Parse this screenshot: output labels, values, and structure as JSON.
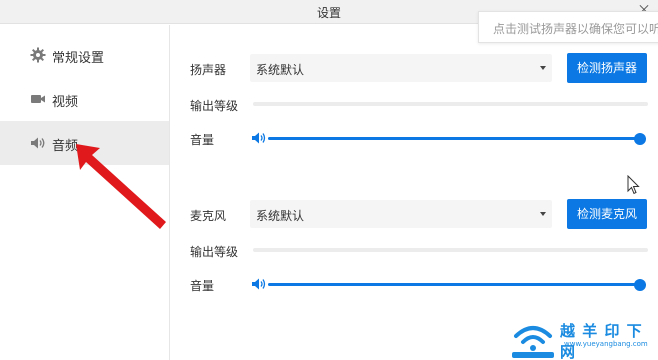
{
  "window": {
    "title": "设置"
  },
  "tooltip": {
    "text": "点击测试扬声器以确保您可以听到"
  },
  "sidebar": {
    "items": [
      {
        "label": "常规设置",
        "icon": "gear-icon",
        "active": false
      },
      {
        "label": "视频",
        "icon": "video-camera-icon",
        "active": false
      },
      {
        "label": "音频",
        "icon": "speaker-icon",
        "active": true
      }
    ]
  },
  "speaker_section": {
    "label": "扬声器",
    "device": "系统默认",
    "test_button": "检测扬声器",
    "level_label": "输出等级",
    "level_value": 0,
    "volume_label": "音量",
    "volume_value": 1.0
  },
  "mic_section": {
    "label": "麦克风",
    "device": "系统默认",
    "test_button": "检测麦克风",
    "level_label": "输出等级",
    "level_value": 0,
    "volume_label": "音量",
    "volume_value": 1.0
  },
  "watermark": {
    "title": "越 羊 印 下 网",
    "url": "www.yueyangbang.com"
  },
  "colors": {
    "accent": "#0b78e3",
    "annotation_arrow": "#e0191c",
    "sidebar_active_bg": "#ececec"
  }
}
